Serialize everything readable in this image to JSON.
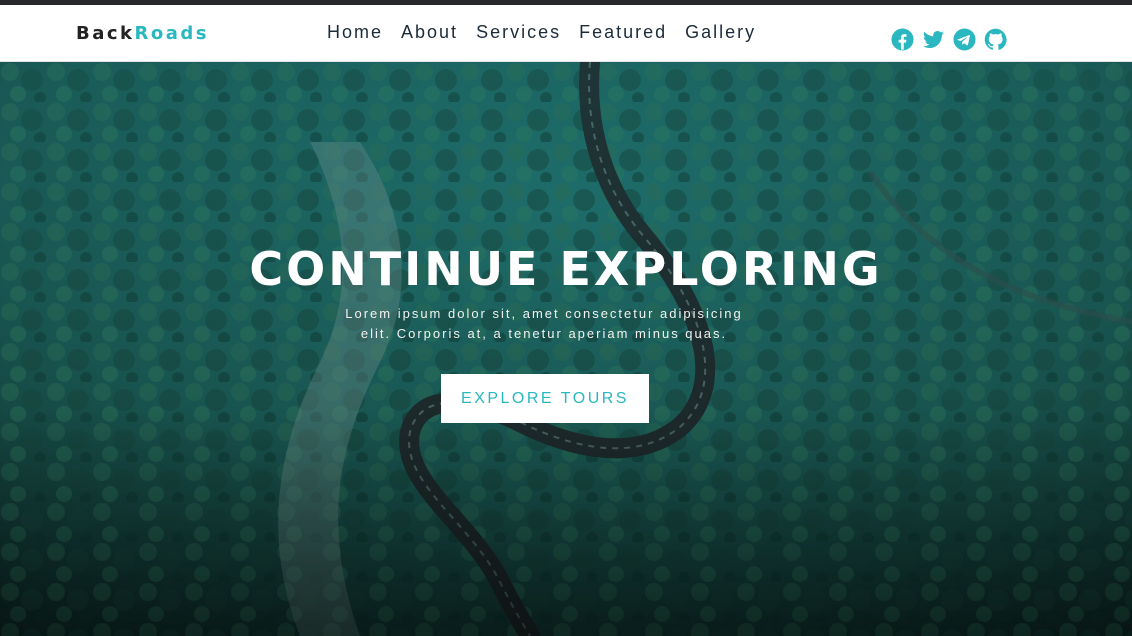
{
  "brand": {
    "part1": "Back",
    "part2": "Roads"
  },
  "nav": {
    "links": [
      "Home",
      "About",
      "Services",
      "Featured",
      "Gallery"
    ]
  },
  "socials": [
    "facebook-icon",
    "twitter-icon",
    "telegram-icon",
    "github-icon"
  ],
  "hero": {
    "title": "CONTINUE EXPLORING",
    "text": "Lorem ipsum dolor sit, amet consectetur adipisicing elit. Corporis at, a tenetur aperiam minus quas.",
    "button_label": "EXPLORE TOURS"
  },
  "colors": {
    "accent": "#2ab7bf",
    "nav_text": "#1c2b3a",
    "logo_dark": "#222222"
  }
}
